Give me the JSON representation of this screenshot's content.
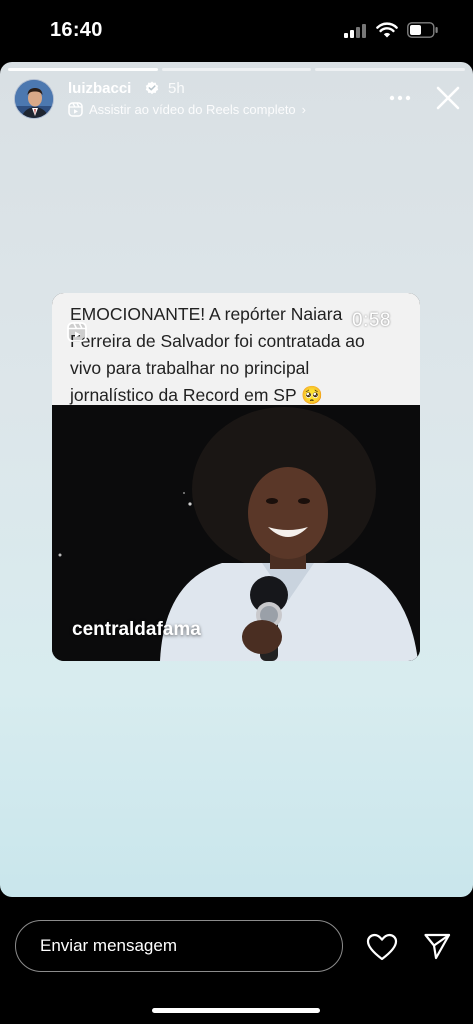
{
  "status_bar": {
    "time": "16:40",
    "icons": [
      "signal-icon",
      "wifi-icon",
      "battery-icon"
    ]
  },
  "story": {
    "progress_segments": 3,
    "progress_completed": 1,
    "user": {
      "username": "luizbacci",
      "verified": true,
      "time_ago": "5h",
      "avatar_icon": "avatar"
    },
    "reels_link_label": "Assistir ao vídeo do Reels completo",
    "reels_link_chevron": "›",
    "background_top": "#d9e0e4",
    "background_bottom": "#c9e6ec"
  },
  "reel": {
    "caption_lines": [
      "EMOCIONANTE! A repórter Naiara",
      "Ferreira de Salvador foi contratada ao",
      "vivo para trabalhar no principal",
      "jornalístico da Record em SP 🥺"
    ],
    "duration": "0:58",
    "watermark": "centraldafama"
  },
  "bottom_bar": {
    "message_placeholder": "Enviar mensagem"
  }
}
